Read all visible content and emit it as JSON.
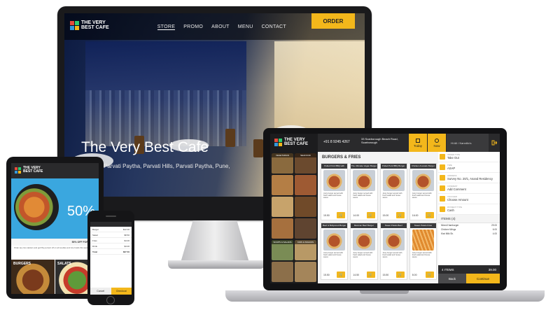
{
  "desktop": {
    "logo": {
      "line1": "THE VERY",
      "line2": "BEST CAFE"
    },
    "nav": [
      "STORE",
      "PROMO",
      "ABOUT",
      "MENU",
      "CONTACT"
    ],
    "order_label": "ORDER",
    "hero_title": "The Very Best Cafe",
    "hero_subtitle": "Parvati Paytha, Parvati Hills, Parvati Paytha, Pune,"
  },
  "laptop": {
    "logo": {
      "line1": "THE VERY",
      "line2": "BEST CAFE"
    },
    "phone": "+91 8 9245 4267",
    "address": "33 Scarborough Beach Road, Scarborough",
    "tabs": [
      {
        "label": "Today"
      },
      {
        "label": "Now"
      }
    ],
    "user": "Hi All / Kannilio's",
    "categories": [
      "VEGETARIAN",
      "SEAFOOD",
      "",
      "",
      "",
      "",
      "",
      "",
      "SOUPS & SALADS",
      "KIDS & SNACKS",
      "",
      ""
    ],
    "section_title": "BURGERS & FRIES",
    "items": [
      {
        "name": "Pulled Pork BBQ with Coleslaw Burger",
        "price": "15.50"
      },
      {
        "name": "The Ultimate Vegan Burger",
        "price": "14.00"
      },
      {
        "name": "Pulled Pork BBQ Burger",
        "price": "15.00"
      },
      {
        "name": "Chicken Avocado Burger",
        "price": "16.00"
      },
      {
        "name": "Beef & Bollywood Burger",
        "price": "15.50"
      },
      {
        "name": "Mexican Beef Burger",
        "price": "14.50"
      },
      {
        "name": "Sweet Potato Beef",
        "price": "15.50"
      },
      {
        "name": "Sweet Potato Fries",
        "price": "8.00"
      }
    ],
    "item_desc": "Juicy burger served with fresh salad and house sauce",
    "order_fields": [
      {
        "label": "ORDER TYPE",
        "value": "Take Out"
      },
      {
        "label": "TIME",
        "value": "ASAP"
      },
      {
        "label": "ADDRESS",
        "value": "Survey No. 20/1, Anand Residency"
      },
      {
        "label": "COMMENT",
        "value": "Add Comment"
      },
      {
        "label": "VOUCHER",
        "value": "Choose Amount"
      },
      {
        "label": "PAYMENT TYPE",
        "value": "Cash"
      }
    ],
    "items_title": "ITEMS (4)",
    "lines": [
      {
        "name": "Mixed Hamburger",
        "price": "29.00"
      },
      {
        "name": "Chicken Wings",
        "price": "6.00"
      },
      {
        "name": "Kiwi Milk Sh.",
        "price": "4.00"
      }
    ],
    "total_label": "4 ITEMS",
    "total_value": "39.00",
    "back_label": "Back",
    "continue_label": "Continue"
  },
  "tablet": {
    "logo": {
      "line1": "THE VERY",
      "line2": "BEST CAFE"
    },
    "promo_big": "50%",
    "promo_strip": "50% OFF FOR ALL N",
    "promo_text": "Order any two starters and get fifty percent off on all noodles and rice bowls this week only.",
    "food_tiles": [
      "BURGERS",
      "SALATS"
    ]
  },
  "phone": {
    "rows": [
      {
        "label": "Burger",
        "value": "$12.00"
      },
      {
        "label": "Salad",
        "value": "$8.50"
      },
      {
        "label": "Fries",
        "value": "$4.00"
      },
      {
        "label": "Drink",
        "value": "$3.00"
      },
      {
        "label": "Total",
        "value": "$27.50"
      }
    ],
    "cancel_label": "Cancel",
    "checkout_label": "Checkout"
  },
  "colors": {
    "accent": "#f3b71b",
    "dark": "#2a2a2c"
  }
}
